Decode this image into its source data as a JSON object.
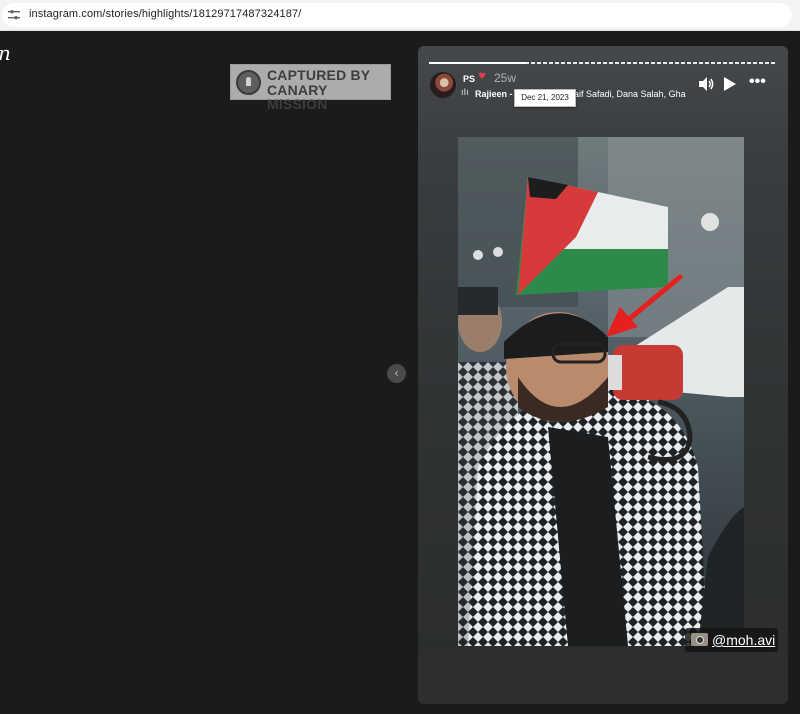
{
  "browser": {
    "url": "instagram.com/stories/highlights/18129717487324187/"
  },
  "page": {
    "logo_fragment": "n",
    "watermark": {
      "line1": "CAPTURED BY",
      "line2": "CANARY MISSION"
    }
  },
  "story": {
    "username": "PS",
    "heart": "♥",
    "time_ago": "25w",
    "music": {
      "title": "Rajieen -",
      "artists": "Saif Safadi, Dana Salah, Gha"
    },
    "tooltip_date": "Dec 21, 2023",
    "more_label": "•••",
    "photo_credit": "@moh.avi",
    "progress_fraction": 0.28
  },
  "navigation": {
    "previous_glyph": "‹"
  },
  "colors": {
    "background": "#1b1b1b",
    "arrow": "#e5201e",
    "flag_red": "#d63a3a",
    "flag_green": "#2c8a4a"
  },
  "icons": [
    "tune-icon",
    "audio-icon",
    "play-icon",
    "more-icon",
    "music-icon",
    "camera-icon",
    "chevron-left-icon",
    "canary-seal-icon"
  ]
}
